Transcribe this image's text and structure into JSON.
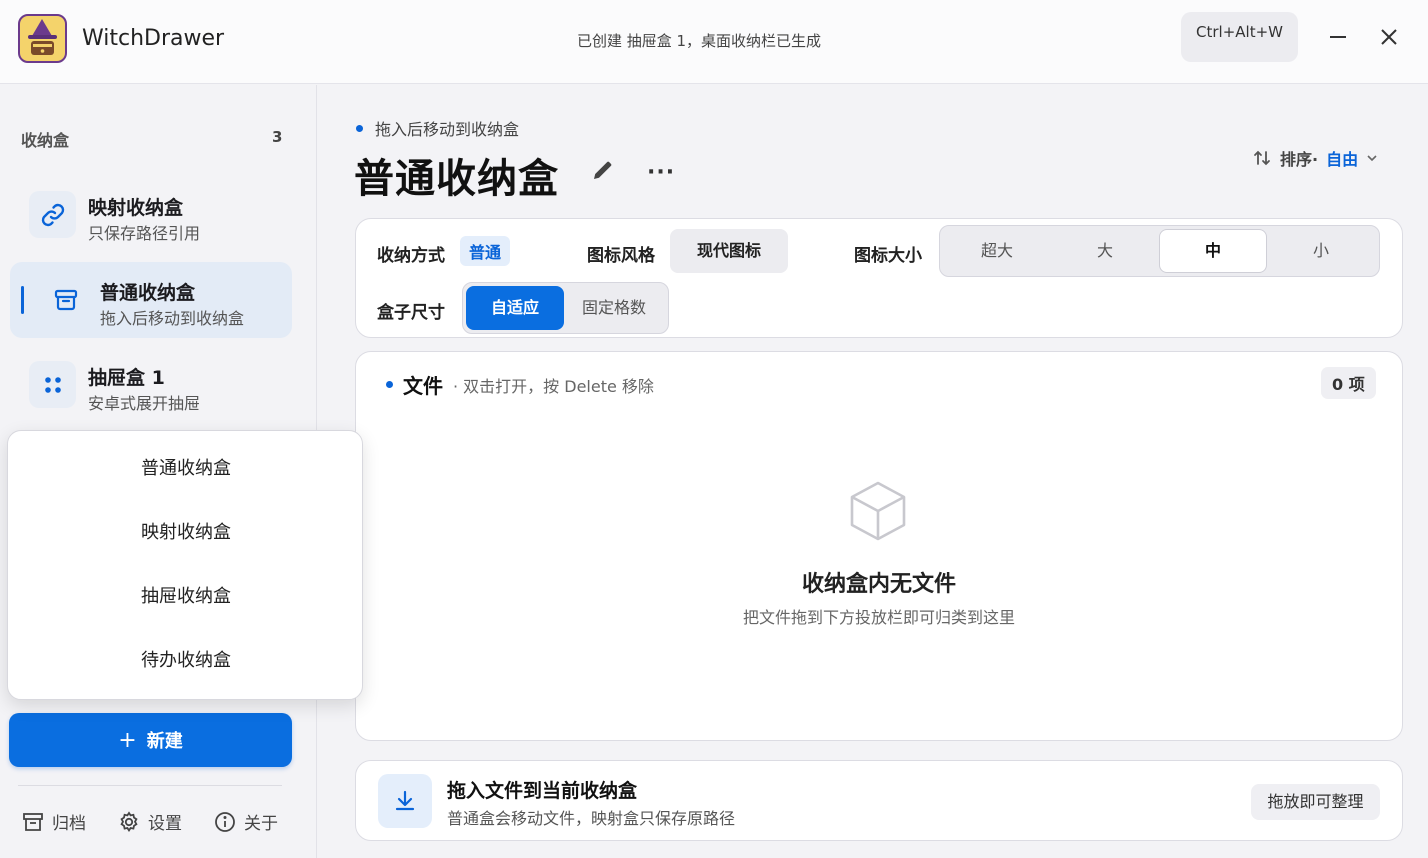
{
  "app": {
    "title": "WitchDrawer",
    "status": "已创建 抽屉盒 1，桌面收纳栏已生成",
    "shortcut": "Ctrl+Alt+W"
  },
  "sidebar": {
    "header": "收纳盒",
    "count": "3",
    "items": [
      {
        "name": "映射收纳盒",
        "desc": "只保存路径引用",
        "icon": "link-icon"
      },
      {
        "name": "普通收纳盒",
        "desc": "拖入后移动到收纳盒",
        "icon": "archive-box-icon"
      },
      {
        "name": "抽屉盒 1",
        "desc": "安卓式展开抽屉",
        "icon": "grid-dots-icon"
      }
    ],
    "new_button": "新建",
    "footer": {
      "archive": "归档",
      "settings": "设置",
      "about": "关于"
    }
  },
  "popup_menu": {
    "items": [
      "普通收纳盒",
      "映射收纳盒",
      "抽屉收纳盒",
      "待办收纳盒"
    ]
  },
  "main": {
    "subtitle": "拖入后移动到收纳盒",
    "title": "普通收纳盒",
    "more": "···",
    "sort_label": "排序·",
    "sort_value": "自由",
    "options": {
      "storage_mode_label": "收纳方式",
      "storage_mode_value": "普通",
      "icon_style_label": "图标风格",
      "icon_style_value": "现代图标",
      "icon_size_label": "图标大小",
      "icon_sizes": [
        "超大",
        "大",
        "中",
        "小"
      ],
      "icon_size_selected": "中",
      "box_size_label": "盒子尺寸",
      "box_sizes": [
        "自适应",
        "固定格数"
      ],
      "box_size_selected": "自适应"
    },
    "files": {
      "title": "文件",
      "hint": "· 双击打开，按 Delete 移除",
      "count": "0 项",
      "empty_title": "收纳盒内无文件",
      "empty_sub": "把文件拖到下方投放栏即可归类到这里"
    },
    "drop": {
      "title": "拖入文件到当前收纳盒",
      "sub": "普通盒会移动文件，映射盒只保存原路径",
      "chip": "拖放即可整理"
    }
  },
  "colors": {
    "accent": "#0a6ee0",
    "accent_light": "#e4eefb"
  }
}
